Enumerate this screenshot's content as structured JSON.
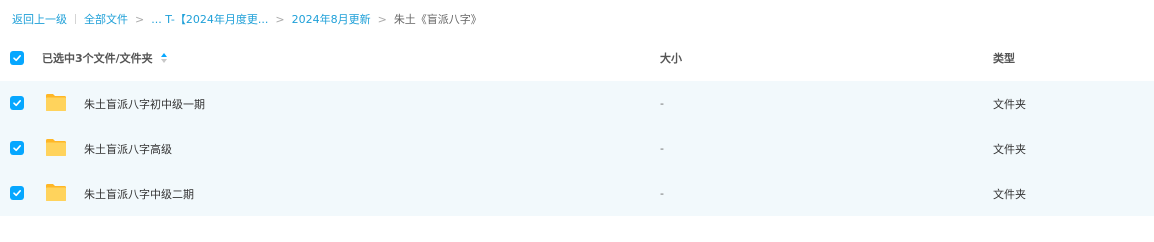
{
  "breadcrumb": {
    "back": "返回上一级",
    "all_files": "全部文件",
    "level1": "... T-【2024年月度更...",
    "level2": "2024年8月更新",
    "current": "朱土《盲派八字》",
    "separator": ">"
  },
  "header": {
    "selected_label": "已选中3个文件/文件夹",
    "size_label": "大小",
    "type_label": "类型"
  },
  "rows": [
    {
      "name": "朱土盲派八字初中级一期",
      "size": "-",
      "type": "文件夹"
    },
    {
      "name": "朱土盲派八字高级",
      "size": "-",
      "type": "文件夹"
    },
    {
      "name": "朱土盲派八字中级二期",
      "size": "-",
      "type": "文件夹"
    }
  ],
  "colors": {
    "accent": "#06a7ff",
    "link": "#1fa0d8",
    "selected_row_bg": "#f2f9fc",
    "folder": "#ffc83d"
  },
  "icons": {
    "checkbox": "check-icon",
    "sort": "sort-icon",
    "folder": "folder-icon"
  }
}
